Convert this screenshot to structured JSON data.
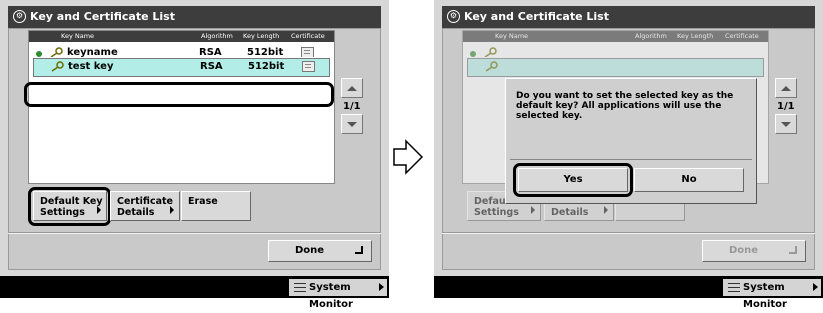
{
  "left_screen": {
    "title": "Key and Certificate List",
    "columns": [
      "Key Name",
      "Algorithm",
      "Key Length",
      "Certificate"
    ],
    "rows": [
      {
        "name": "keyname",
        "algorithm": "RSA",
        "length": "512bit"
      },
      {
        "name": "test key",
        "algorithm": "RSA",
        "length": "512bit"
      }
    ],
    "page_indicator": "1/1",
    "buttons": {
      "default_key_line1": "Default Key",
      "default_key_line2": "Settings",
      "cert_details_line1": "Certificate",
      "cert_details_line2": "Details",
      "erase": "Erase"
    },
    "done": "Done",
    "system_monitor": "System Monitor"
  },
  "right_screen": {
    "title": "Key and Certificate List",
    "columns": [
      "Key Name",
      "Algorithm",
      "Key Length",
      "Certificate"
    ],
    "page_indicator": "1/1",
    "dialog": {
      "message": "Do you want to set the selected key as the default key? All applications will use the selected key.",
      "yes": "Yes",
      "no": "No"
    },
    "buttons_dim": {
      "default_line1": "Default Ke",
      "default_line2": "Settings",
      "details": "Details"
    },
    "done": "Done",
    "system_monitor": "System Monitor"
  },
  "colors": {
    "title_bar": "#3d3d3d",
    "selected_row": "#b2eee7",
    "panel_bg": "#d7d7d7",
    "status_dot": "#2e8b2e"
  }
}
